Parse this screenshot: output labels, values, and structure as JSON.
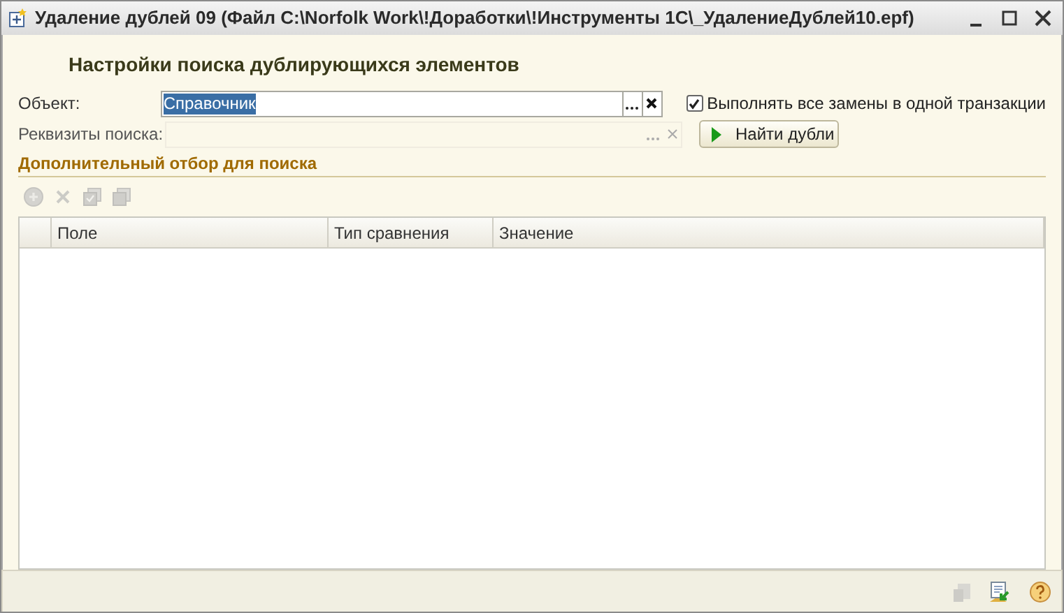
{
  "window": {
    "title": "Удаление дублей 09 (Файл C:\\Norfolk Work\\!Доработки\\!Инструменты 1С\\_УдалениеДублей10.epf)"
  },
  "heading": "Настройки поиска дублирующихся элементов",
  "fields": [
    {
      "label": "Объект:",
      "value": "Справочник",
      "selected": true,
      "disabled": false
    },
    {
      "label": "Реквизиты поиска:",
      "disabled": true
    }
  ],
  "transaction_checkbox": {
    "label": "Выполнять все замены в одной транзакции",
    "checked": true
  },
  "find_button": {
    "label": "Найти дубли"
  },
  "section_title": "Дополнительный отбор для поиска",
  "toolbar": [
    {
      "kind": "add",
      "disabled": true
    },
    {
      "kind": "delete",
      "disabled": true
    },
    {
      "kind": "check-all",
      "disabled": true
    },
    {
      "kind": "uncheck-all",
      "disabled": true
    }
  ],
  "table": {
    "columns": [
      {
        "label": "Поле"
      },
      {
        "label": "Тип сравнения"
      },
      {
        "label": "Значение"
      }
    ]
  },
  "footer_buttons": [
    {
      "kind": "move",
      "disabled": true
    },
    {
      "kind": "export",
      "disabled": false
    },
    {
      "kind": "help",
      "disabled": false
    }
  ]
}
